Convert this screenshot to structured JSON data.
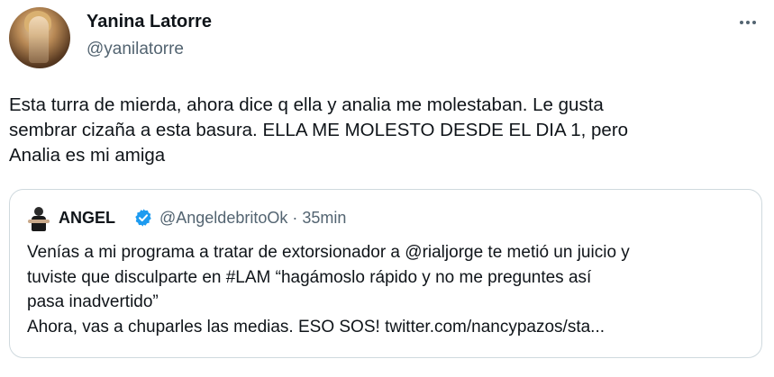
{
  "author": {
    "display_name": "Yanina Latorre",
    "handle": "@yanilatorre"
  },
  "more_icon": "more-horizontal-icon",
  "tweet": {
    "text": "Esta turra de mierda, ahora dice q ella y analia me molestaban. Le gusta\nsembrar  cizaña a esta basura. ELLA ME MOLESTO DESDE EL DIA 1, pero\nAnalia es mi amiga"
  },
  "quoted": {
    "name": "ANGEL",
    "verified": true,
    "verified_color": "#1d9bf0",
    "handle_time": "@AngeldebritoOk · 35min",
    "text": "Venías a mi programa a tratar de extorsionador a @rialjorge te metió un juicio y\ntuviste que disculparte en #LAM “hagámoslo rápido y no me preguntes así\npasa inadvertido”\nAhora, vas a chuparles las medias. ESO SOS! twitter.com/nancypazos/sta..."
  },
  "colors": {
    "text": "#0f1419",
    "secondary": "#536471",
    "border": "#cfd9de"
  }
}
